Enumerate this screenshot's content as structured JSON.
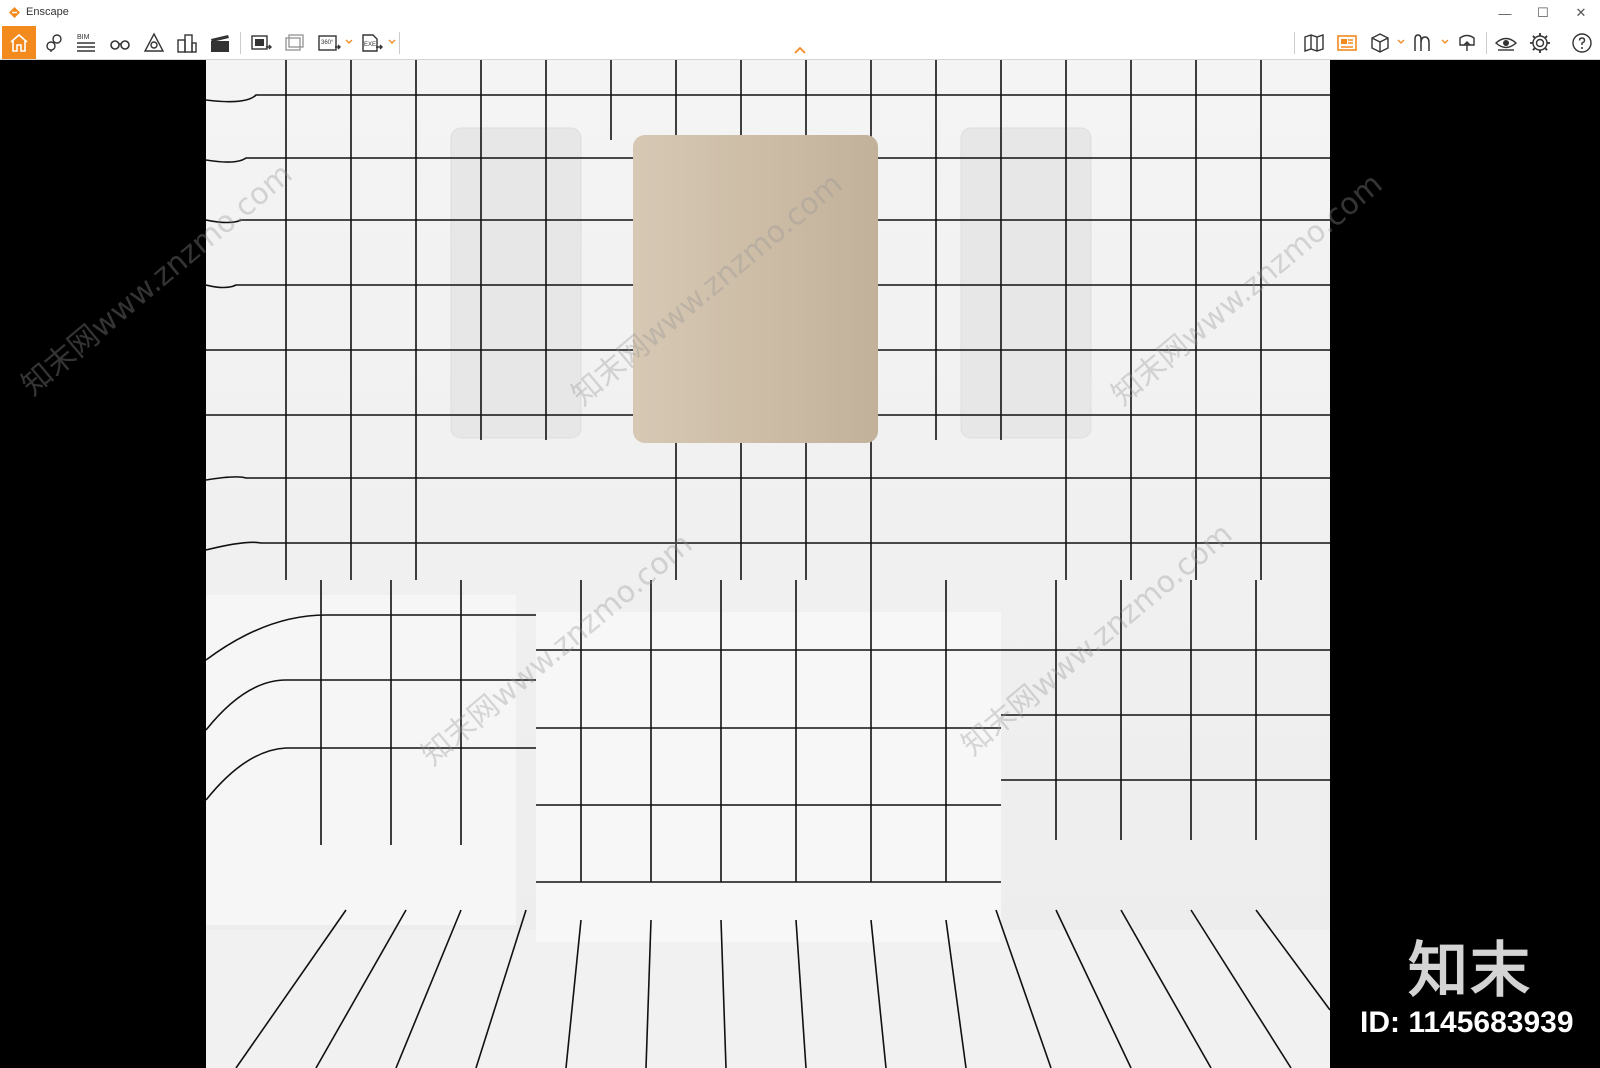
{
  "window": {
    "title": "Enscape",
    "controls": {
      "minimize": "—",
      "maximize": "☐",
      "close": "✕"
    }
  },
  "toolbar": {
    "left_icons": [
      "home-icon",
      "location-pin-icon",
      "bim-list-icon",
      "binoculars-icon",
      "light-view-icon",
      "buildings-icon",
      "clapperboard-icon",
      "screenshot-icon",
      "batch-render-icon",
      "panorama-360-icon",
      "exe-export-icon"
    ],
    "bim_label": "BIM",
    "pano_label": "360°",
    "exe_label": "EXE",
    "right_icons": [
      "map-icon",
      "view-management-icon",
      "asset-cube-icon",
      "material-editor-icon",
      "upload-icon",
      "visual-settings-icon",
      "settings-gear-icon",
      "help-icon"
    ],
    "accent_color": "#f28a1e"
  },
  "watermark": {
    "brand": "知末",
    "id_label": "ID: 1145683939",
    "diagonal_text": "知末网www.znzmo.com"
  }
}
